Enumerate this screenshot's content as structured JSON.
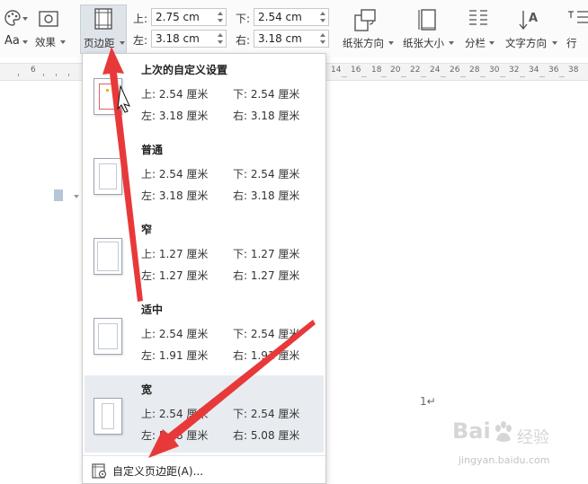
{
  "toolbar": {
    "font_size_label": "Aa",
    "effect_label": "效果",
    "margins_label": "页边距",
    "orientation_label": "纸张方向",
    "size_label": "纸张大小",
    "columns_label": "分栏",
    "text_direction_label": "文字方向",
    "linenum_label": "行",
    "margin_fields": {
      "top_label": "上:",
      "top_value": "2.75 cm",
      "bottom_label": "下:",
      "bottom_value": "2.54 cm",
      "left_label": "左:",
      "left_value": "3.18 cm",
      "right_label": "右:",
      "right_value": "3.18 cm"
    }
  },
  "ruler": {
    "labels": [
      "6",
      "14",
      "16",
      "18",
      "20",
      "22",
      "24",
      "26",
      "28",
      "30",
      "32",
      "34",
      "36",
      "38",
      "40",
      "42"
    ]
  },
  "document": {
    "page_number": "1↵"
  },
  "margins_menu": {
    "presets": [
      {
        "title": "上次的自定义设置",
        "top": "上: 2.54 厘米",
        "bottom": "下: 2.54 厘米",
        "left": "左: 3.18 厘米",
        "right": "右: 3.18 厘米"
      },
      {
        "title": "普通",
        "top": "上: 2.54 厘米",
        "bottom": "下: 2.54 厘米",
        "left": "左: 3.18 厘米",
        "right": "右: 3.18 厘米"
      },
      {
        "title": "窄",
        "top": "上: 1.27 厘米",
        "bottom": "下: 1.27 厘米",
        "left": "左: 1.27 厘米",
        "right": "右: 1.27 厘米"
      },
      {
        "title": "适中",
        "top": "上: 2.54 厘米",
        "bottom": "下: 2.54 厘米",
        "left": "左: 1.91 厘米",
        "right": "右: 1.91 厘米"
      },
      {
        "title": "宽",
        "top": "上: 2.54 厘米",
        "bottom": "下: 2.54 厘米",
        "left": "左: 5.08 厘米",
        "right": "右: 5.08 厘米"
      }
    ],
    "custom_label": "自定义页边距(A)..."
  },
  "watermark": {
    "brand": "Bai",
    "brand2": "经验",
    "url": "jingyan.baidu.com"
  },
  "colors": {
    "arrow": "#e8393a",
    "highlight": "#e8ecf1",
    "active_button": "#dfe3ea"
  }
}
